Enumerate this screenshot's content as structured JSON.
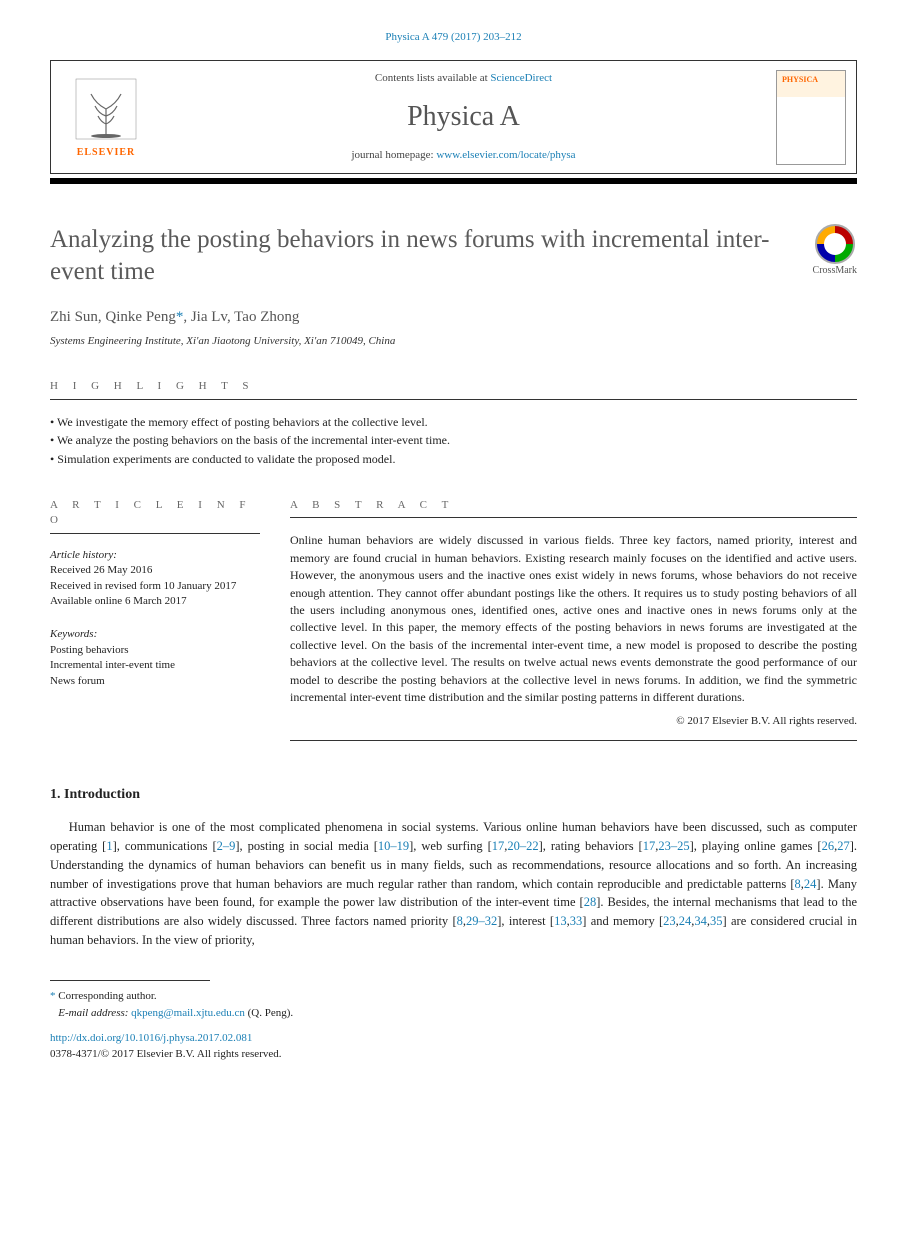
{
  "journal_ref": "Physica A 479 (2017) 203–212",
  "header": {
    "contents_prefix": "Contents lists available at ",
    "contents_link": "ScienceDirect",
    "journal_name": "Physica A",
    "homepage_prefix": "journal homepage: ",
    "homepage_url": "www.elsevier.com/locate/physa",
    "publisher": "ELSEVIER"
  },
  "title": "Analyzing the posting behaviors in news forums with incremental inter-event time",
  "crossmark_label": "CrossMark",
  "authors_line": "Zhi Sun, Qinke Peng",
  "corr_marker": "*",
  "authors_tail": ", Jia Lv, Tao Zhong",
  "affiliation": "Systems Engineering Institute, Xi'an Jiaotong University, Xi'an 710049, China",
  "highlights_label": "h i g h l i g h t s",
  "highlights": [
    "We investigate the memory effect of posting behaviors at the collective level.",
    "We analyze the posting behaviors on the basis of the incremental inter-event time.",
    "Simulation experiments are conducted to validate the proposed model."
  ],
  "article_info_label": "a r t i c l e   i n f o",
  "abstract_label": "a b s t r a c t",
  "article_history_label": "Article history:",
  "history": [
    "Received 26 May 2016",
    "Received in revised form 10 January 2017",
    "Available online 6 March 2017"
  ],
  "keywords_label": "Keywords:",
  "keywords": [
    "Posting behaviors",
    "Incremental inter-event time",
    "News forum"
  ],
  "abstract": "Online human behaviors are widely discussed in various fields. Three key factors, named priority, interest and memory are found crucial in human behaviors. Existing research mainly focuses on the identified and active users. However, the anonymous users and the inactive ones exist widely in news forums, whose behaviors do not receive enough attention. They cannot offer abundant postings like the others. It requires us to study posting behaviors of all the users including anonymous ones, identified ones, active ones and inactive ones in news forums only at the collective level. In this paper, the memory effects of the posting behaviors in news forums are investigated at the collective level. On the basis of the incremental inter-event time, a new model is proposed to describe the posting behaviors at the collective level. The results on twelve actual news events demonstrate the good performance of our model to describe the posting behaviors at the collective level in news forums. In addition, we find the symmetric incremental inter-event time distribution and the similar posting patterns in different durations.",
  "abstract_copyright": "© 2017 Elsevier B.V. All rights reserved.",
  "intro_heading": "1. Introduction",
  "intro_body": {
    "p1a": "Human behavior is one of the most complicated phenomena in social systems. Various online human behaviors have been discussed, such as computer operating [",
    "r1": "1",
    "p1b": "], communications [",
    "r2": "2–9",
    "p1c": "], posting in social media [",
    "r3": "10–19",
    "p1d": "], web surfing [",
    "r4": "17",
    "p1d2": ",",
    "r4b": "20–22",
    "p1e": "], rating behaviors [",
    "r5": "17",
    "p1e2": ",",
    "r5b": "23–25",
    "p1f": "], playing online games [",
    "r6": "26",
    "p1f2": ",",
    "r6b": "27",
    "p1g": "]. Understanding the dynamics of human behaviors can benefit us in many fields, such as recommendations, resource allocations and so forth. An increasing number of investigations prove that human behaviors are much regular rather than random, which contain reproducible and predictable patterns [",
    "r7": "8",
    "p1g2": ",",
    "r7b": "24",
    "p1h": "]. Many attractive observations have been found, for example the power law distribution of the inter-event time [",
    "r8": "28",
    "p1i": "]. Besides, the internal mechanisms that lead to the different distributions are also widely discussed. Three factors named priority [",
    "r9": "8",
    "p1i2": ",",
    "r9b": "29–32",
    "p1j": "], interest [",
    "r10": "13",
    "p1j2": ",",
    "r10b": "33",
    "p1k": "] and memory [",
    "r11": "23",
    "p1k2": ",",
    "r11b": "24",
    "p1k3": ",",
    "r11c": "34",
    "p1k4": ",",
    "r11d": "35",
    "p1l": "] are considered crucial in human behaviors. In the view of priority,"
  },
  "footnote": {
    "corr_label": "Corresponding author.",
    "email_label": "E-mail address:",
    "email": "qkpeng@mail.xjtu.edu.cn",
    "email_suffix": "(Q. Peng)."
  },
  "doi": "http://dx.doi.org/10.1016/j.physa.2017.02.081",
  "issn_line": "0378-4371/© 2017 Elsevier B.V. All rights reserved."
}
